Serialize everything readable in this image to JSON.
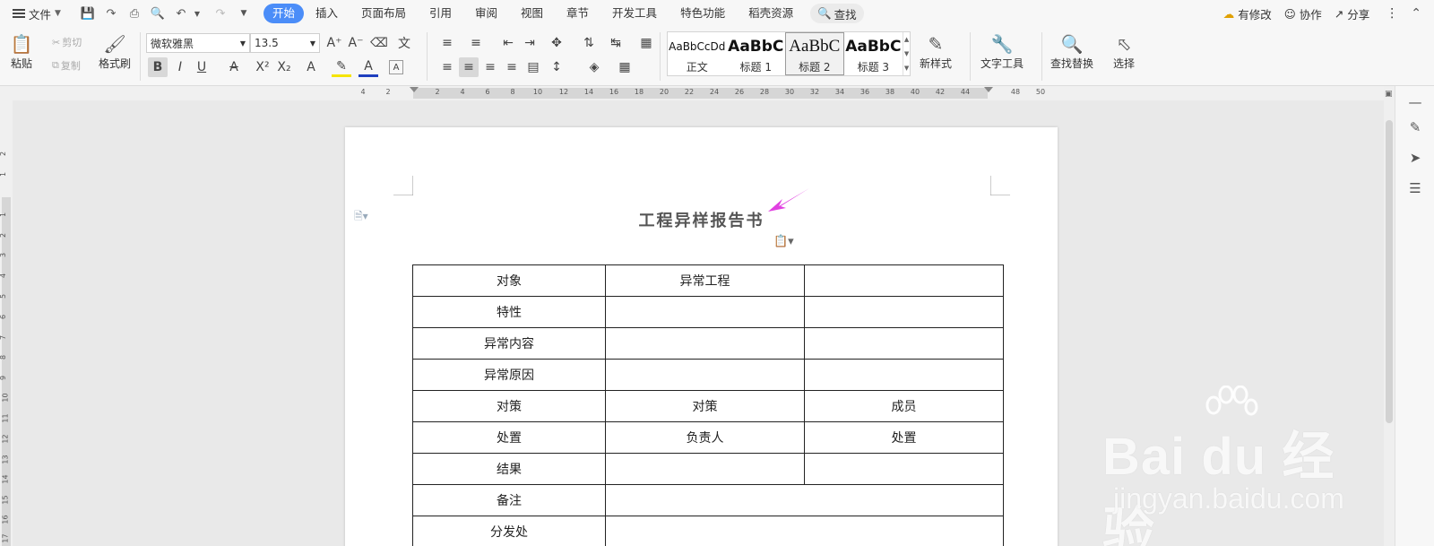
{
  "menubar": {
    "file_label": "文件",
    "tabs": [
      "开始",
      "插入",
      "页面布局",
      "引用",
      "审阅",
      "视图",
      "章节",
      "开发工具",
      "特色功能",
      "稻壳资源"
    ],
    "search_label": "查找",
    "right": {
      "changes": "有修改",
      "collab": "协作",
      "share": "分享"
    }
  },
  "ribbon": {
    "paste": "粘贴",
    "cut": "剪切",
    "copy": "复制",
    "format_painter": "格式刷",
    "font_name": "微软雅黑",
    "font_size": "13.5",
    "styles": [
      {
        "sample": "AaBbCcDd",
        "label": "正文"
      },
      {
        "sample": "AaBbC",
        "label": "标题 1"
      },
      {
        "sample": "AaBbC",
        "label": "标题 2"
      },
      {
        "sample": "AaBbC",
        "label": "标题 3"
      }
    ],
    "new_style": "新样式",
    "text_tools": "文字工具",
    "find_replace": "查找替换",
    "select": "选择"
  },
  "ruler": {
    "h_labels": [
      "4",
      "2",
      "2",
      "4",
      "6",
      "8",
      "10",
      "12",
      "14",
      "16",
      "18",
      "20",
      "22",
      "24",
      "26",
      "28",
      "30",
      "32",
      "34",
      "36",
      "38",
      "40",
      "42",
      "44",
      "48",
      "50"
    ],
    "v_labels": [
      "2",
      "1",
      "1",
      "2",
      "3",
      "4",
      "5",
      "6",
      "7",
      "8",
      "9",
      "10",
      "11",
      "12",
      "13",
      "14",
      "15",
      "16",
      "17"
    ]
  },
  "document": {
    "title": "工程异样报告书",
    "table": [
      [
        "对象",
        "异常工程",
        ""
      ],
      [
        "特性",
        "",
        ""
      ],
      [
        "异常内容",
        "",
        ""
      ],
      [
        "异常原因",
        "",
        ""
      ],
      [
        "对策",
        "对策",
        "成员"
      ],
      [
        "处置",
        "负责人",
        "处置"
      ],
      [
        "结果",
        "",
        ""
      ],
      [
        "备注",
        ""
      ],
      [
        "分发处",
        ""
      ]
    ]
  },
  "watermark": {
    "line1": "Bai du 经验",
    "line2": "jingyan.baidu.com"
  },
  "colors": {
    "accent": "#4b8df8",
    "arrow": "#e040e0"
  }
}
